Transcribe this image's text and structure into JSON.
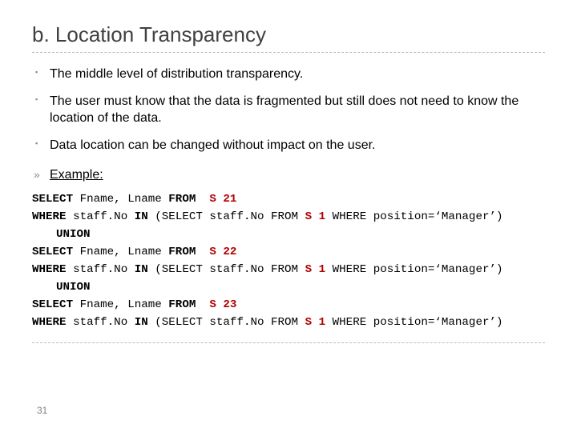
{
  "title": "b. Location Transparency",
  "bullets": [
    "The middle level of distribution transparency.",
    "The user must know that the data is fragmented but still does not need to know the location of the data.",
    "Data location can be changed without impact on the user."
  ],
  "example_label": "Example:",
  "sql": {
    "kw_select": "SELECT",
    "kw_from": "FROM",
    "kw_where": "WHERE",
    "kw_in": "IN",
    "kw_union": "UNION",
    "cols": "Fname, Lname",
    "staff_col": "staff.No",
    "open_sub": "(SELECT staff.No FROM ",
    "close_sub": " WHERE position=‘Manager’)",
    "s21": "S 21",
    "s22": "S 22",
    "s23": "S 23",
    "s1": "S 1"
  },
  "page_number": "31"
}
